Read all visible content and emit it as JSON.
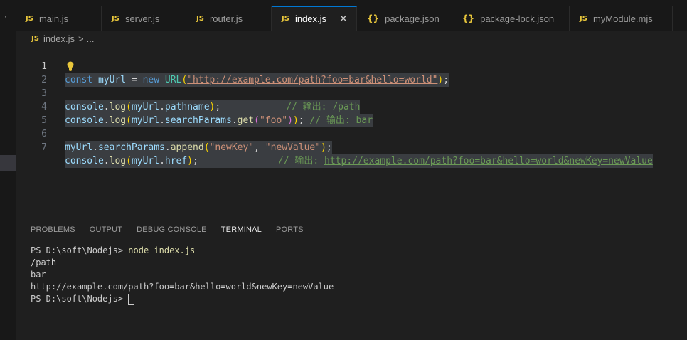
{
  "tabs": [
    {
      "icon": "JS",
      "label": "main.js"
    },
    {
      "icon": "JS",
      "label": "server.js"
    },
    {
      "icon": "JS",
      "label": "router.js"
    },
    {
      "icon": "JS",
      "label": "index.js",
      "active": true
    },
    {
      "icon": "{}",
      "label": "package.json"
    },
    {
      "icon": "{}",
      "label": "package-lock.json"
    },
    {
      "icon": "JS",
      "label": "myModule.mjs"
    }
  ],
  "breadcrumb": {
    "icon": "JS",
    "file": "index.js",
    "sep": ">",
    "rest": "..."
  },
  "code": {
    "line_numbers": [
      "1",
      "2",
      "3",
      "4",
      "5",
      "6",
      "7"
    ],
    "l1": {
      "kw1": "const",
      "var": "myUrl",
      "op": "=",
      "kw2": "new",
      "cls": "URL",
      "p1": "(",
      "str": "\"http://example.com/path?foo=bar&hello=world\"",
      "p2": ")",
      "end": ";"
    },
    "l3": {
      "obj": "console",
      "dot": ".",
      "fn": "log",
      "p1": "(",
      "v1": "myUrl",
      "dot2": ".",
      "v2": "pathname",
      "p2": ")",
      "end": ";",
      "cmt": "// 输出: /path"
    },
    "l4": {
      "obj": "console",
      "fn": "log",
      "v1": "myUrl",
      "v2": "searchParams",
      "fn2": "get",
      "str": "\"foo\"",
      "end": ";",
      "cmt": "// 输出: bar"
    },
    "l6": {
      "v1": "myUrl",
      "v2": "searchParams",
      "fn": "append",
      "str1": "\"newKey\"",
      "comma": ",",
      "str2": "\"newValue\"",
      "end": ";"
    },
    "l7": {
      "obj": "console",
      "fn": "log",
      "v1": "myUrl",
      "v2": "href",
      "end": ";",
      "cmt_prefix": "// 输出: ",
      "cmt_url": "http://example.com/path?foo=bar&hello=world&newKey=newValue"
    }
  },
  "panel": {
    "tabs": [
      "PROBLEMS",
      "OUTPUT",
      "DEBUG CONSOLE",
      "TERMINAL",
      "PORTS"
    ],
    "active_tab": "TERMINAL"
  },
  "terminal": {
    "prompt": "PS D:\\soft\\Nodejs> ",
    "command": "node index.js",
    "out1": "/path",
    "out2": "bar",
    "out3": "http://example.com/path?foo=bar&hello=world&newKey=newValue",
    "prompt2": "PS D:\\soft\\Nodejs> "
  }
}
